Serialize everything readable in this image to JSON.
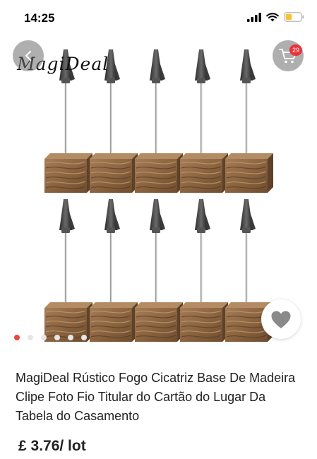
{
  "status_bar": {
    "time": "14:25",
    "icons": [
      "signal-icon",
      "wifi-icon",
      "battery-icon"
    ],
    "battery_color": "#f6c234"
  },
  "gallery": {
    "watermark": "MagiDeal",
    "current_index": 1,
    "total_images": 6,
    "back_icon": "chevron-left-icon",
    "cart_icon": "cart-icon",
    "cart_count": "29",
    "wishlist_icon": "heart-icon"
  },
  "product": {
    "title": "MagiDeal Rústico Fogo Cicatriz Base De Madeira Clipe Foto Fio Titular do Cartão do Lugar Da Tabela do Casamento",
    "price": "£ 3.76/ lot"
  },
  "colors": {
    "accent": "#e8483b",
    "badge": "#e8343a",
    "overlay_button": "#6e6e6e"
  }
}
